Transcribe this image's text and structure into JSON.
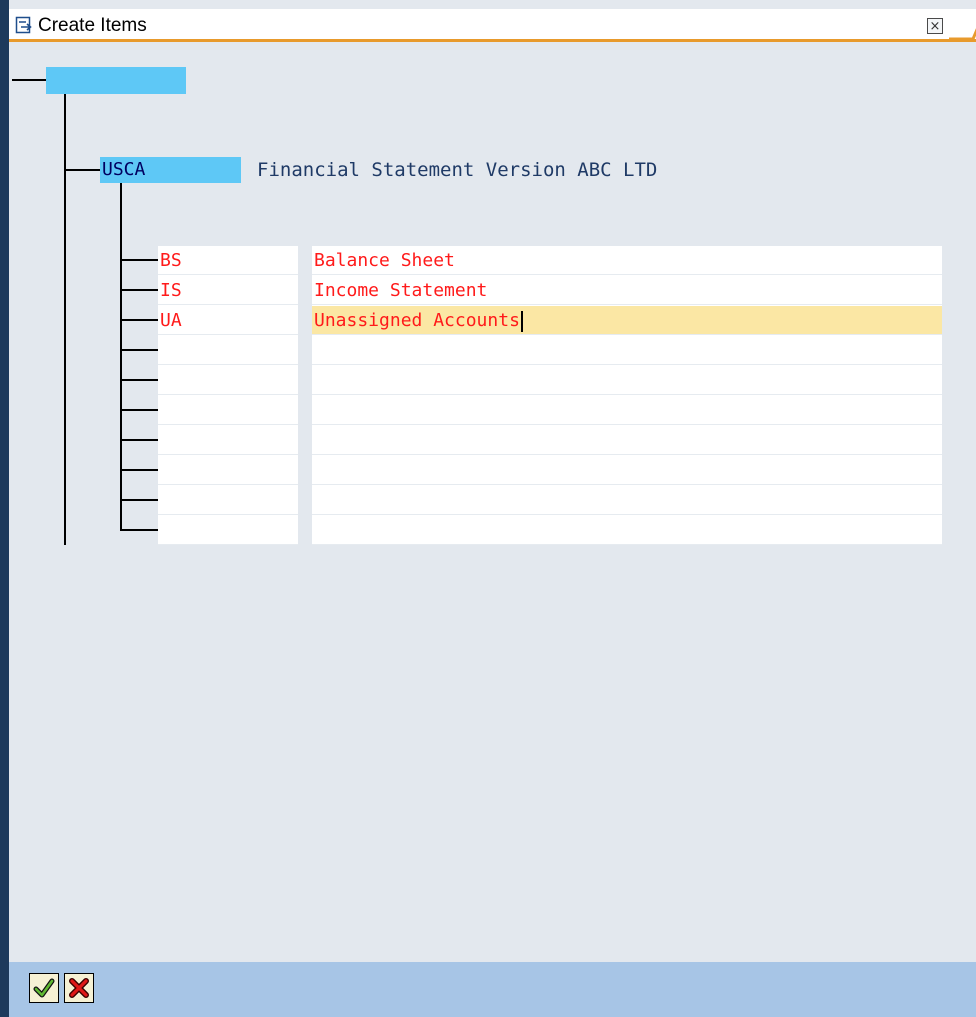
{
  "window": {
    "title": "Create Items",
    "title_icon": "create-document-icon",
    "close_icon": "close-icon",
    "close_glyph": "×"
  },
  "tree": {
    "root_node": {
      "label": ""
    },
    "fsv": {
      "key": "USCA",
      "description": "Financial Statement Version ABC LTD"
    },
    "items": [
      {
        "code": "BS",
        "description": "Balance Sheet"
      },
      {
        "code": "IS",
        "description": "Income Statement"
      },
      {
        "code": "UA",
        "description": "Unassigned Accounts"
      },
      {
        "code": "",
        "description": ""
      },
      {
        "code": "",
        "description": ""
      },
      {
        "code": "",
        "description": ""
      },
      {
        "code": "",
        "description": ""
      },
      {
        "code": "",
        "description": ""
      },
      {
        "code": "",
        "description": ""
      },
      {
        "code": "",
        "description": ""
      }
    ]
  },
  "footer": {
    "confirm_icon": "checkmark-icon",
    "cancel_icon": "cancel-x-icon"
  },
  "colors": {
    "accent_orange": "#e89a2c",
    "node_highlight": "#5ec8f6",
    "new_item_text": "#ff1a1a",
    "active_field": "#fbe7a4",
    "footer_bar": "#a7c5e6",
    "window_frame": "#1d3a5c"
  }
}
